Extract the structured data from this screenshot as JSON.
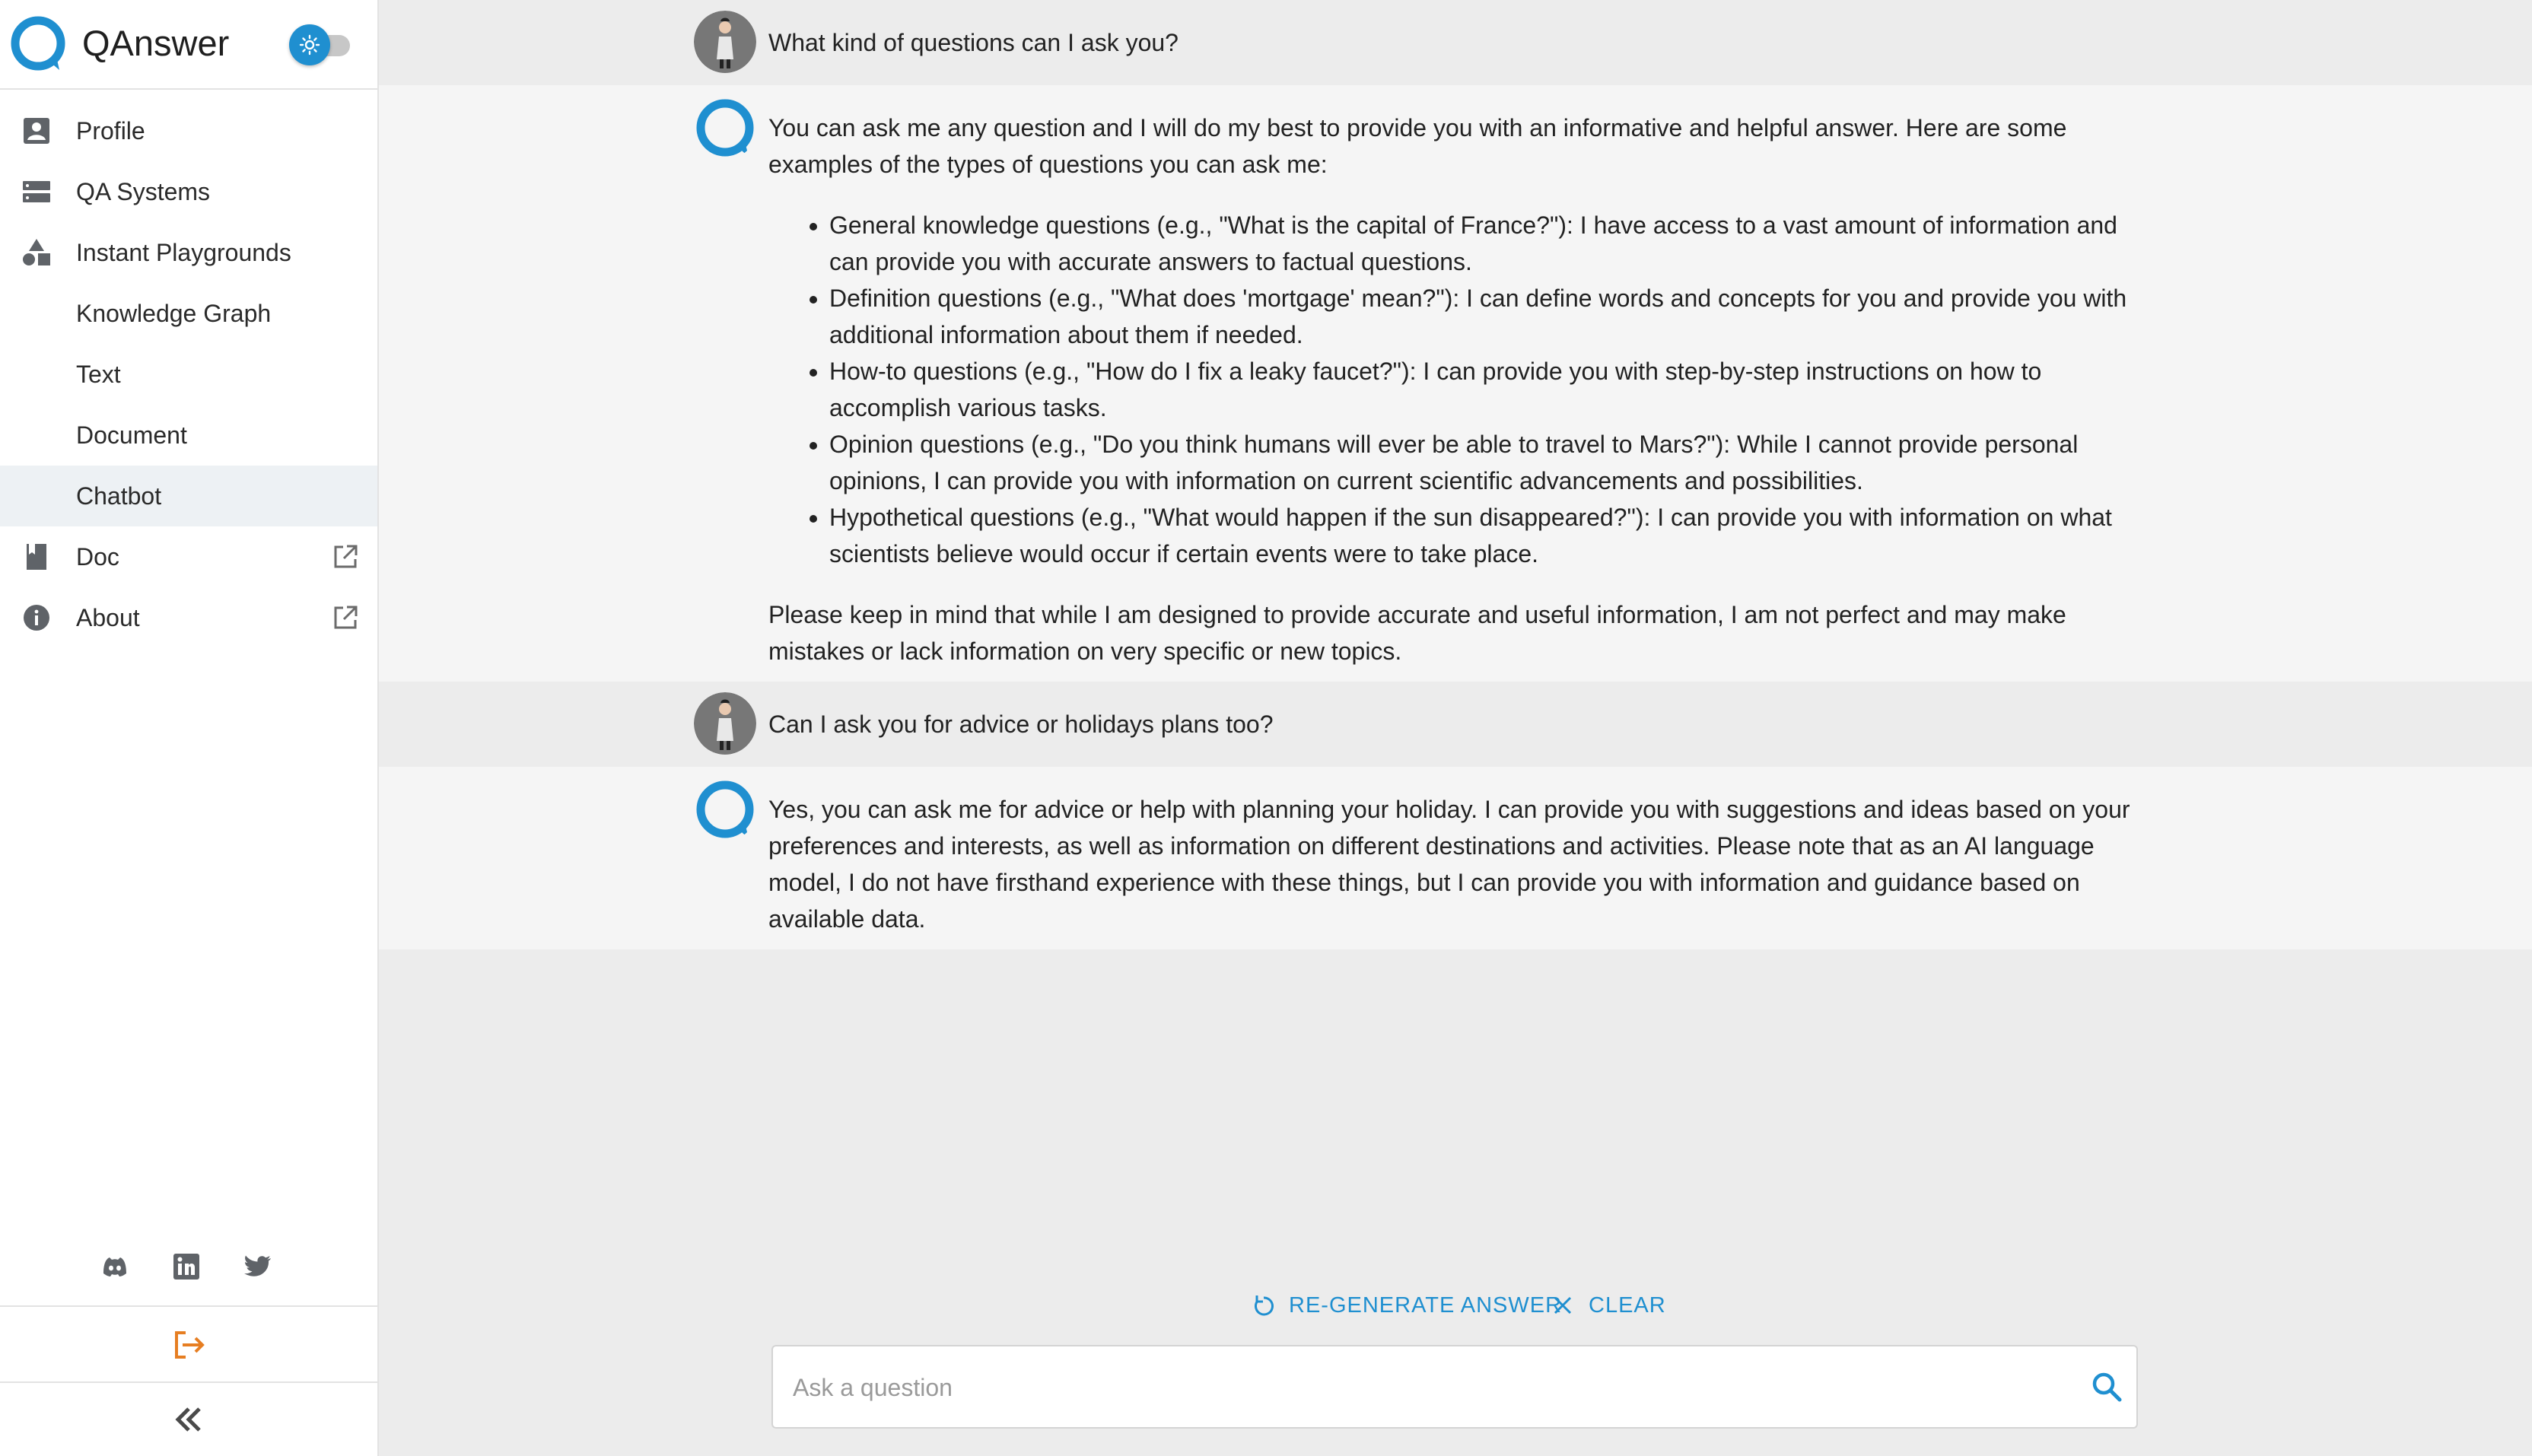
{
  "brand": {
    "name": "QAnswer"
  },
  "sidebar": {
    "items": [
      {
        "label": "Profile"
      },
      {
        "label": "QA Systems"
      },
      {
        "label": "Instant Playgrounds"
      },
      {
        "label": "Knowledge Graph"
      },
      {
        "label": "Text"
      },
      {
        "label": "Document"
      },
      {
        "label": "Chatbot"
      },
      {
        "label": "Doc"
      },
      {
        "label": "About"
      }
    ],
    "active_item": "Chatbot",
    "socials": [
      "discord-icon",
      "linkedin-icon",
      "twitter-icon"
    ]
  },
  "colors": {
    "accent": "#1f8fd0",
    "logout": "#e67e22",
    "active_bg": "#edf1f4"
  },
  "chat": {
    "messages": [
      {
        "role": "user",
        "text": "What kind of questions can I ask you?"
      },
      {
        "role": "bot",
        "intro": "You can ask me any question and I will do my best to provide you with an informative and helpful answer. Here are some examples of the types of questions you can ask me:",
        "bullets": [
          "General knowledge questions (e.g., \"What is the capital of France?\"): I have access to a vast amount of information and can provide you with accurate answers to factual questions.",
          "Definition questions (e.g., \"What does 'mortgage' mean?\"): I can define words and concepts for you and provide you with additional information about them if needed.",
          "How-to questions (e.g., \"How do I fix a leaky faucet?\"): I can provide you with step-by-step instructions on how to accomplish various tasks.",
          "Opinion questions (e.g., \"Do you think humans will ever be able to travel to Mars?\"): While I cannot provide personal opinions, I can provide you with information on current scientific advancements and possibilities.",
          "Hypothetical questions (e.g., \"What would happen if the sun disappeared?\"): I can provide you with information on what scientists believe would occur if certain events were to take place."
        ],
        "outro": "Please keep in mind that while I am designed to provide accurate and useful information, I am not perfect and may make mistakes or lack information on very specific or new topics."
      },
      {
        "role": "user",
        "text": "Can I ask you for advice or holidays plans too?"
      },
      {
        "role": "bot",
        "text": "Yes, you can ask me for advice or help with planning your holiday. I can provide you with suggestions and ideas based on your preferences and interests, as well as information on different destinations and activities. Please note that as an AI language model, I do not have firsthand experience with these things, but I can provide you with information and guidance based on available data."
      }
    ]
  },
  "actions": {
    "regenerate_label": "RE-GENERATE ANSWER",
    "clear_label": "CLEAR"
  },
  "input": {
    "placeholder": "Ask a question",
    "value": ""
  }
}
